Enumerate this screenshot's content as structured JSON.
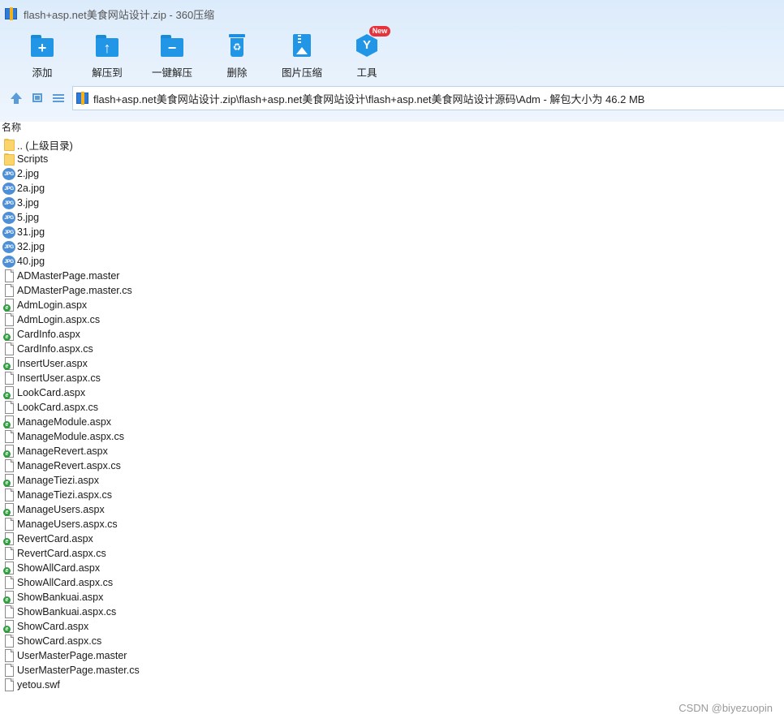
{
  "window": {
    "title": "flash+asp.net美食网站设计.zip - 360压缩"
  },
  "toolbar": [
    {
      "label": "添加",
      "icon": "add-icon"
    },
    {
      "label": "解压到",
      "icon": "extract-to-icon"
    },
    {
      "label": "一键解压",
      "icon": "one-click-extract-icon"
    },
    {
      "label": "删除",
      "icon": "delete-icon"
    },
    {
      "label": "图片压缩",
      "icon": "image-compress-icon"
    },
    {
      "label": "工具",
      "icon": "tools-icon",
      "badge": "New"
    }
  ],
  "address": {
    "path": "flash+asp.net美食网站设计.zip\\flash+asp.net美食网站设计\\flash+asp.net美食网站设计源码\\Adm - 解包大小为 46.2 MB"
  },
  "list": {
    "column_name": "名称",
    "files": [
      {
        "name": ".. (上级目录)",
        "type": "folder"
      },
      {
        "name": "Scripts",
        "type": "folder"
      },
      {
        "name": "2.jpg",
        "type": "jpg"
      },
      {
        "name": "2a.jpg",
        "type": "jpg"
      },
      {
        "name": "3.jpg",
        "type": "jpg"
      },
      {
        "name": "5.jpg",
        "type": "jpg"
      },
      {
        "name": "31.jpg",
        "type": "jpg"
      },
      {
        "name": "32.jpg",
        "type": "jpg"
      },
      {
        "name": "40.jpg",
        "type": "jpg"
      },
      {
        "name": "ADMasterPage.master",
        "type": "doc"
      },
      {
        "name": "ADMasterPage.master.cs",
        "type": "doc"
      },
      {
        "name": "AdmLogin.aspx",
        "type": "aspx"
      },
      {
        "name": "AdmLogin.aspx.cs",
        "type": "doc"
      },
      {
        "name": "CardInfo.aspx",
        "type": "aspx"
      },
      {
        "name": "CardInfo.aspx.cs",
        "type": "doc"
      },
      {
        "name": "InsertUser.aspx",
        "type": "aspx"
      },
      {
        "name": "InsertUser.aspx.cs",
        "type": "doc"
      },
      {
        "name": "LookCard.aspx",
        "type": "aspx"
      },
      {
        "name": "LookCard.aspx.cs",
        "type": "doc"
      },
      {
        "name": "ManageModule.aspx",
        "type": "aspx"
      },
      {
        "name": "ManageModule.aspx.cs",
        "type": "doc"
      },
      {
        "name": "ManageRevert.aspx",
        "type": "aspx"
      },
      {
        "name": "ManageRevert.aspx.cs",
        "type": "doc"
      },
      {
        "name": "ManageTiezi.aspx",
        "type": "aspx"
      },
      {
        "name": "ManageTiezi.aspx.cs",
        "type": "doc"
      },
      {
        "name": "ManageUsers.aspx",
        "type": "aspx"
      },
      {
        "name": "ManageUsers.aspx.cs",
        "type": "doc"
      },
      {
        "name": "RevertCard.aspx",
        "type": "aspx"
      },
      {
        "name": "RevertCard.aspx.cs",
        "type": "doc"
      },
      {
        "name": "ShowAllCard.aspx",
        "type": "aspx"
      },
      {
        "name": "ShowAllCard.aspx.cs",
        "type": "doc"
      },
      {
        "name": "ShowBankuai.aspx",
        "type": "aspx"
      },
      {
        "name": "ShowBankuai.aspx.cs",
        "type": "doc"
      },
      {
        "name": "ShowCard.aspx",
        "type": "aspx"
      },
      {
        "name": "ShowCard.aspx.cs",
        "type": "doc"
      },
      {
        "name": "UserMasterPage.master",
        "type": "doc"
      },
      {
        "name": "UserMasterPage.master.cs",
        "type": "doc"
      },
      {
        "name": "yetou.swf",
        "type": "doc"
      }
    ]
  },
  "watermark": "CSDN @biyezuopin",
  "colors": {
    "accent": "#2196e6",
    "header_bg": "#dcebfb",
    "badge": "#e8323b"
  }
}
